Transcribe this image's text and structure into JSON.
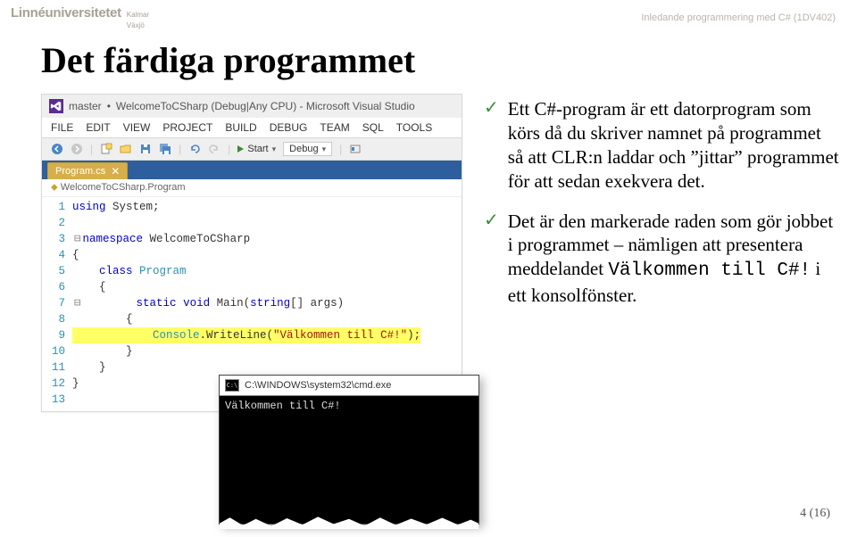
{
  "header": {
    "logo_main": "Linnéuniversitetet",
    "logo_sub_1": "Kalmar",
    "logo_sub_2": "Växjö",
    "course": "Inledande programmering med C# (1DV402)"
  },
  "slide": {
    "title": "Det färdiga programmet"
  },
  "vs": {
    "title_prefix": "master",
    "title_dot": "•",
    "title_main": "WelcomeToCSharp (Debug|Any CPU) - Microsoft Visual Studio",
    "menu": [
      "FILE",
      "EDIT",
      "VIEW",
      "PROJECT",
      "BUILD",
      "DEBUG",
      "TEAM",
      "SQL",
      "TOOLS"
    ],
    "toolbar": {
      "start": "Start",
      "config": "Debug"
    },
    "tab": "Program.cs",
    "breadcrumb": "WelcomeToCSharp.Program",
    "code": {
      "l1_using": "using",
      "l1_rest": " System;",
      "l3_ns": "namespace",
      "l3_rest": " WelcomeToCSharp",
      "l4": "{",
      "l5_kw": "    class",
      "l5_rest": " Program",
      "l6": "    {",
      "l7_kw1": "        static",
      "l7_kw2": " void",
      "l7_rest1": " Main(",
      "l7_kw3": "string",
      "l7_rest2": "[] args)",
      "l8": "        {",
      "l9_cls": "            Console",
      "l9_rest": ".WriteLine(",
      "l9_str": "\"Välkommen till C#!\"",
      "l9_end": ");",
      "l10": "        }",
      "l11": "    }",
      "l12": "}"
    }
  },
  "cmd": {
    "title": "C:\\WINDOWS\\system32\\cmd.exe",
    "output": "Välkommen till C#!"
  },
  "bullets": {
    "b1": "Ett C#-program är ett datorprogram som körs då du skriver namnet på programmet så att CLR:n laddar och ”jittar” programmet för att sedan exekvera det.",
    "b2_a": "Det är den markerade raden som gör jobbet i programmet – nämligen att presentera meddelandet ",
    "b2_code": "Välkommen till C#!",
    "b2_b": " i ett konsolfönster."
  },
  "page_num": "4 (16)"
}
